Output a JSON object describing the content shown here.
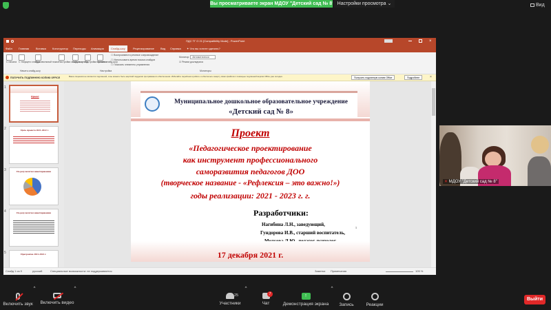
{
  "zoom": {
    "share_banner": "Вы просматриваете экран МДОУ \"Детский сад № 8\"",
    "view_options": "Настройки просмотра ⌄",
    "view_button": "Вид",
    "toolbar": {
      "mute": "Включить звук",
      "video": "Включить видео",
      "participants": "Участники",
      "participants_count": "25",
      "chat": "Чат",
      "chat_badge": "7",
      "share": "Демонстрация экрана",
      "record": "Запись",
      "reactions": "Реакции",
      "exit": "Выйти"
    },
    "colors": {
      "share_green": "#3fbd52",
      "exit_red": "#e02828"
    }
  },
  "ppt": {
    "window_title": "ПДС ТГ О 21 [Compatibility Mode] - PowerPoint",
    "tabs": [
      "Файл",
      "Главная",
      "Вставка",
      "Конструктор",
      "Переходы",
      "Анимация",
      "Слайд-шоу",
      "Рецензирование",
      "Вид",
      "Справка"
    ],
    "active_tab": "Слайд-шоу",
    "tell_me": "Что вы хотите сделать?",
    "ribbon": {
      "groups": [
        "Начать слайд-шоу",
        "Настройка",
        "Мониторы"
      ],
      "buttons": [
        "С начала",
        "С текущего слайда",
        "Произвольный показ",
        "Настройка слайд-шоу",
        "Скрыть слайд",
        "Настройка времени",
        "Запись слайд-шоу"
      ],
      "checks": [
        "Воспроизвести речевое сопровождение",
        "Использовать время показа слайдов",
        "Показать элементы управления"
      ],
      "monitor_label": "Монитор:",
      "monitor_value": "Автоматически",
      "presenter_view": "Режим докладчика"
    },
    "warning": {
      "label": "ПОЛУЧИТЬ ПОДЛИННУЮ КОПИЮ OFFICE",
      "text": "Ваша лицензия не является подлинной, и вы можете быть жертвой подделки программного обеспечения. Избегайте перебоев в работе и обеспечьте защиту своих файлов с помощью подлинной версии Office уже сегодня.",
      "btn_primary": "Получить подлинную копию Office",
      "btn_more": "Подробнее"
    },
    "thumbnails": [
      {
        "num": "1",
        "title": "Проект"
      },
      {
        "num": "2",
        "title": "Цель проекта 2021-2022 г."
      },
      {
        "num": "3",
        "title": "По результатам анкетирования"
      },
      {
        "num": "4",
        "title": "По результатам анкетирования"
      },
      {
        "num": "5",
        "title": "Программа 2021-2022 г."
      }
    ],
    "status": {
      "slide": "Слайд 1 из 9",
      "language": "русский",
      "accessibility": "Специальные возможности: не поддерживается",
      "notes": "Заметки",
      "comments": "Примечания",
      "zoom": "105 %"
    },
    "slide": {
      "org_line1": "Муниципальное дошкольное образовательное учреждение",
      "org_line2": "«Детский сад № 8»",
      "project_word": "Проект",
      "title_lines": [
        "«Педагогическое проектирование",
        "как инструмент профессионального",
        "саморазвития педагогов ДОО",
        "(творческое название - «Рефлексия – это важно!»)",
        "годы реализации: 2021 - 2023 г. г."
      ],
      "developers_title": "Разработчики:",
      "developers": [
        "Нагибина Л.Н., заведующий,",
        "Гундорова И.В., старший воспитатель,",
        "Медкова Л.Ю., педагог-психолог"
      ],
      "page_mark": "1",
      "date": "17 декабря 2021 г.",
      "accent_color": "#c00000"
    }
  },
  "video": {
    "name": "МДОУ \"Детский сад № 8\""
  }
}
